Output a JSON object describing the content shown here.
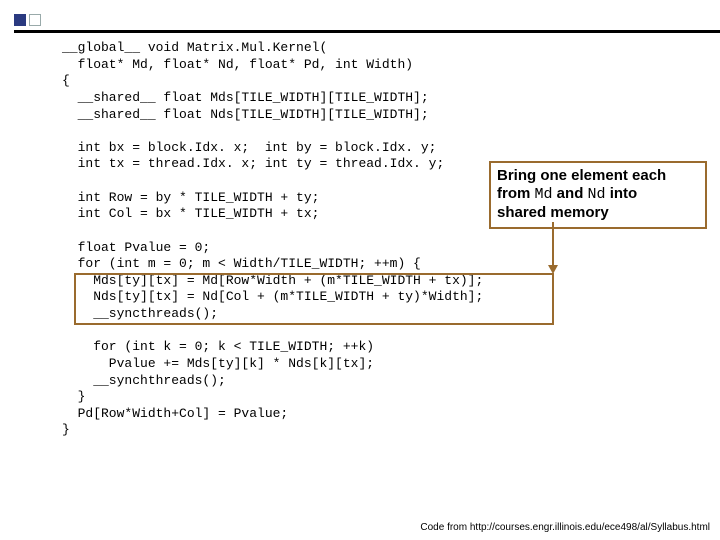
{
  "code": {
    "l01": "__global__ void Matrix.Mul.Kernel(",
    "l02": "  float* Md, float* Nd, float* Pd, int Width)",
    "l03": "{",
    "l04": "  __shared__ float Mds[TILE_WIDTH][TILE_WIDTH];",
    "l05": "  __shared__ float Nds[TILE_WIDTH][TILE_WIDTH];",
    "l06": "",
    "l07": "  int bx = block.Idx. x;  int by = block.Idx. y;",
    "l08": "  int tx = thread.Idx. x; int ty = thread.Idx. y;",
    "l09": "",
    "l10": "  int Row = by * TILE_WIDTH + ty;",
    "l11": "  int Col = bx * TILE_WIDTH + tx;",
    "l12": "",
    "l13": "  float Pvalue = 0;",
    "l14": "  for (int m = 0; m < Width/TILE_WIDTH; ++m) {",
    "l15": "    Mds[ty][tx] = Md[Row*Width + (m*TILE_WIDTH + tx)];",
    "l16": "    Nds[ty][tx] = Nd[Col + (m*TILE_WIDTH + ty)*Width];",
    "l17": "    __syncthreads();",
    "l18": "",
    "l19": "    for (int k = 0; k < TILE_WIDTH; ++k)",
    "l20": "      Pvalue += Mds[ty][k] * Nds[k][tx];",
    "l21": "    __synchthreads();",
    "l22": "  }",
    "l23": "  Pd[Row*Width+Col] = Pvalue;",
    "l24": "}"
  },
  "callout": {
    "line1a": "Bring one element each",
    "line2a": "from ",
    "line2b": "Md",
    "line2c": " and ",
    "line2d": "Nd",
    "line2e": " into",
    "line3": "shared memory"
  },
  "credit": "Code from http://courses.engr.illinois.edu/ece498/al/Syllabus.html"
}
